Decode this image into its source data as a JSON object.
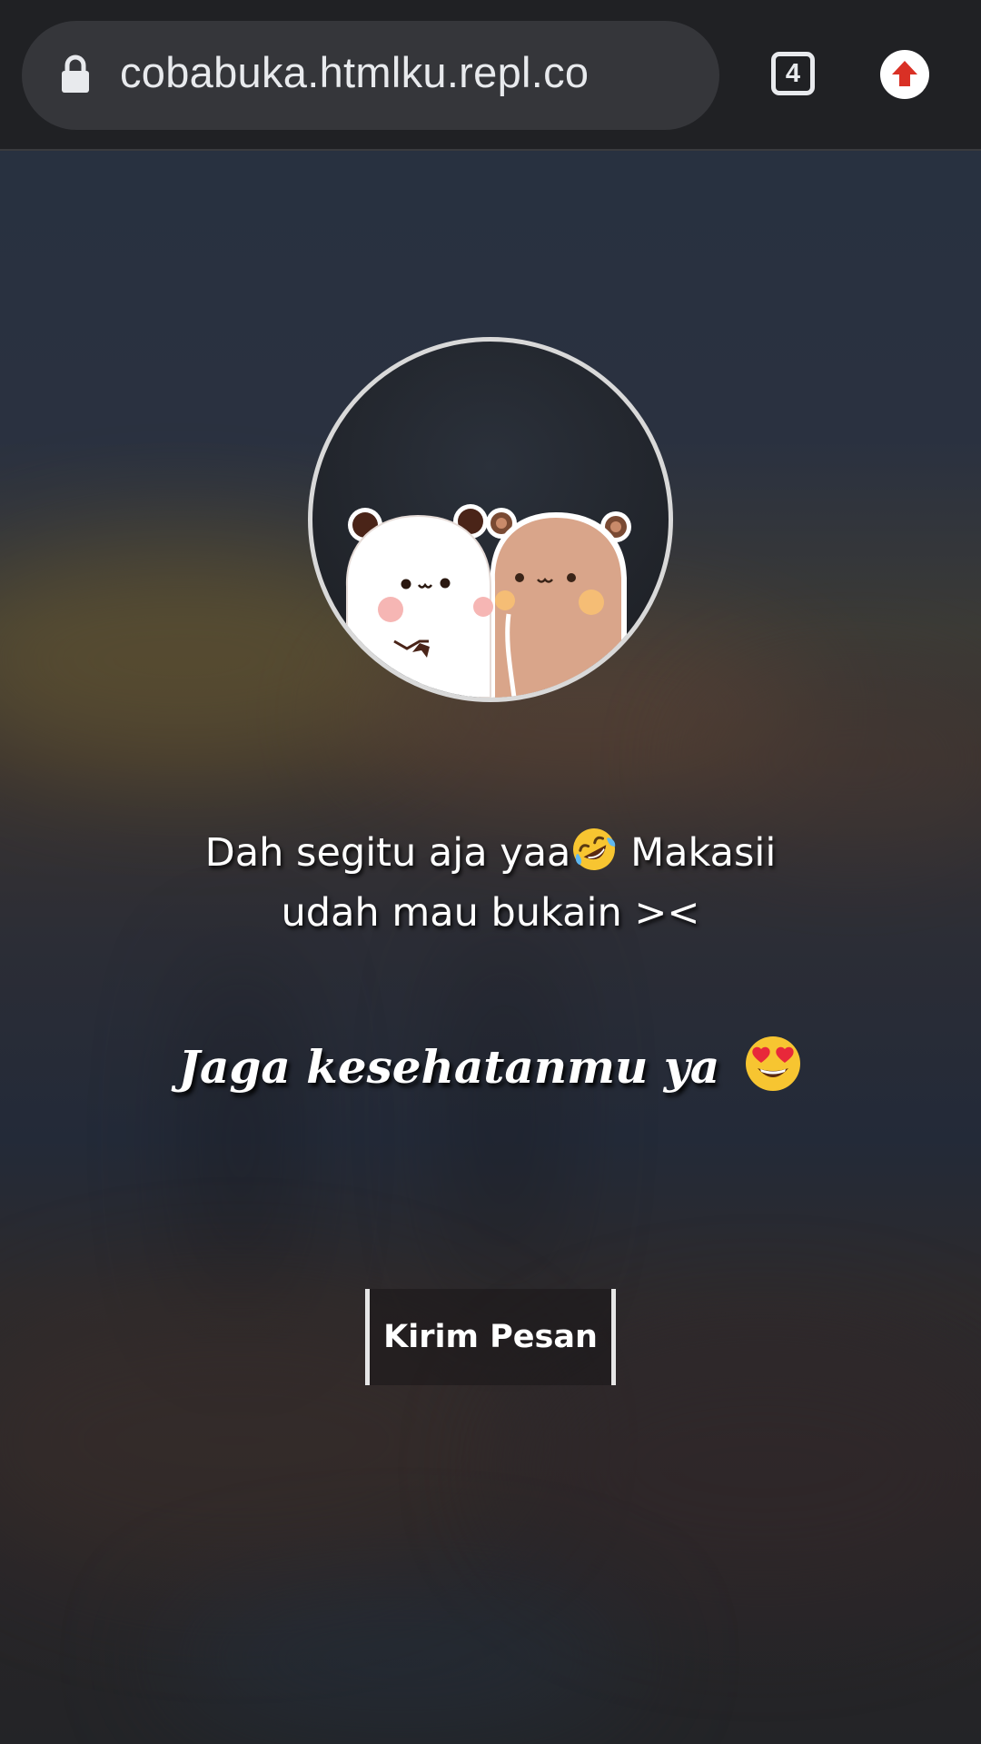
{
  "browser": {
    "url": "cobabuka.htmlku.repl.co",
    "tab_count": "4",
    "icons": {
      "lock": "lock-icon",
      "update": "arrow-up-circle-icon"
    },
    "colors": {
      "bar": "#202124",
      "pill": "#35363a",
      "update_arrow": "#d93025"
    }
  },
  "content": {
    "avatar_image": "panda-and-bear-hugging-sticker",
    "message_line1": "Dah segitu aja yaa",
    "message_emoji": "rolling-on-the-floor-laughing-emoji",
    "message_line1_end": " Makasii",
    "message_line2": "udah mau bukain ><",
    "wish_text": "Jaga kesehatanmu ya ",
    "wish_emoji": "heart-eyes-emoji",
    "button_label": "Kirim Pesan"
  }
}
